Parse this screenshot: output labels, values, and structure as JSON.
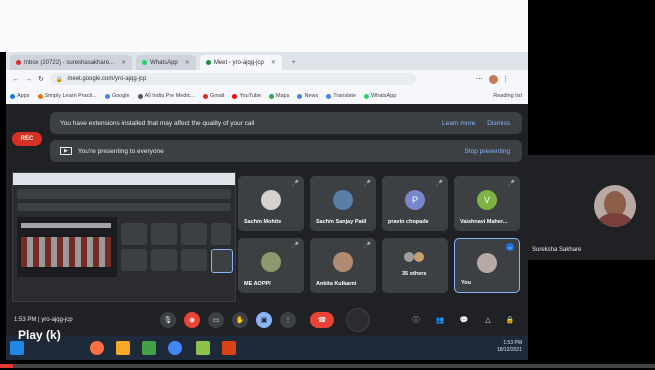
{
  "browser": {
    "tabs": [
      {
        "label": "Inbox (20722) - sureshasakhare...",
        "icon_color": "#d93025"
      },
      {
        "label": "WhatsApp",
        "icon_color": "#25d366"
      },
      {
        "label": "Meet - yro-ajqg-jcp",
        "icon_color": "#1e8e3e",
        "active": true
      }
    ],
    "url": "meet.google.com/yro-ajqg-jcp",
    "bookmarks": [
      "Apps",
      "Simply Learn Practi...",
      "Google",
      "All India Pre Medic...",
      "Gmail",
      "YouTube",
      "Maps",
      "News",
      "Translate",
      "WhatsApp",
      "Reading list"
    ]
  },
  "meet": {
    "rec_label": "REC",
    "banner1": "You have extensions installed that may affect the quality of your call",
    "learn_more": "Learn more",
    "dismiss": "Dismiss",
    "banner2": "You're presenting to everyone",
    "stop_presenting": "Stop presenting",
    "time_code": "1:53 PM  |  yro-ajqg-jcp",
    "participants": [
      {
        "name": "Sachin Mohite"
      },
      {
        "name": "Sachin Sanjay Patil"
      },
      {
        "name": "pravin chopade",
        "initial": "P"
      },
      {
        "name": "Vaishnavi Maher...",
        "initial": "V"
      },
      {
        "name": "ME AOPPI"
      },
      {
        "name": "Ankita Kulkarni"
      },
      {
        "name": "35 others"
      },
      {
        "name": "You"
      }
    ],
    "others_count": "35"
  },
  "right_participant": {
    "name": "Sureksha Sakhare"
  },
  "player": {
    "play_label": "Play (k)",
    "progress_fraction": 0.02
  },
  "taskbar": {
    "clock_time": "1:53 PM",
    "clock_date": "18/12/2021"
  }
}
